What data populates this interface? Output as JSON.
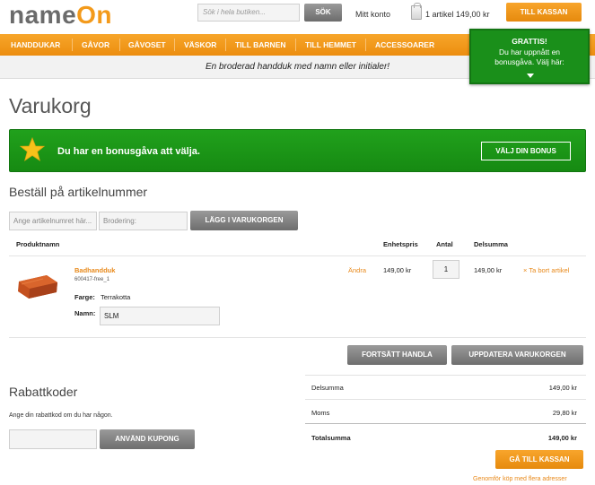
{
  "header": {
    "logo_name": "name",
    "logo_on": "On",
    "search_placeholder": "Sök i hela butiken...",
    "search_button": "SÖK",
    "account_link": "Mitt konto",
    "cart_summary": "1 artikel 149,00 kr",
    "checkout_button": "TILL KASSAN"
  },
  "nav": {
    "items": [
      "HANDDUKAR",
      "GÅVOR",
      "GÅVOSET",
      "VÄSKOR",
      "TILL BARNEN",
      "TILL HEMMET",
      "ACCESSOARER"
    ]
  },
  "subbar": {
    "text": "En broderad handduk med namn eller initialer!"
  },
  "gift_popup": {
    "title": "GRATTIS!",
    "line1": "Du har uppnått en",
    "line2": "bonusgåva. Välj här:"
  },
  "page": {
    "title": "Varukorg"
  },
  "bonus": {
    "text": "Du har en bonusgåva att välja.",
    "button": "VÄLJ DIN BONUS",
    "icon": "star-icon",
    "color": "#1a9a16"
  },
  "order_by_sku": {
    "title": "Beställ på artikelnummer",
    "sku_placeholder": "Ange artikelnumret här...",
    "embroidery_placeholder": "Brodering:",
    "add_button": "LÄGG I VARUKORGEN"
  },
  "cart_table": {
    "headers": {
      "product": "Produktnamn",
      "unit_price": "Enhetspris",
      "qty": "Antal",
      "subtotal": "Delsumma"
    },
    "items": [
      {
        "name": "Badhandduk",
        "sku": "600417-free_1",
        "color_label": "Farge:",
        "color_value": "Terrakotta",
        "name_label": "Namn:",
        "name_value": "SLM",
        "edit": "Ändra",
        "unit_price": "149,00 kr",
        "qty": "1",
        "subtotal": "149,00 kr",
        "remove": "× Ta bort artikel"
      }
    ]
  },
  "actions": {
    "continue_button": "FORTSÄTT HANDLA",
    "update_button": "UPPDATERA VARUKORGEN"
  },
  "coupon": {
    "title": "Rabattkoder",
    "hint": "Ange din rabattkod om du har någon.",
    "apply_button": "ANVÄND KUPONG"
  },
  "totals": {
    "subtotal_label": "Delsumma",
    "subtotal_value": "149,00 kr",
    "vat_label": "Moms",
    "vat_value": "29,80 kr",
    "total_label": "Totalsumma",
    "total_value": "149,00 kr"
  },
  "checkout": {
    "button": "GÅ TILL KASSAN",
    "multi_address_link": "Genomför köp med flera adresser"
  },
  "colors": {
    "brand_orange": "#f39a1b",
    "bonus_green": "#1a9a16",
    "gray_button": "#7e7e7e"
  }
}
